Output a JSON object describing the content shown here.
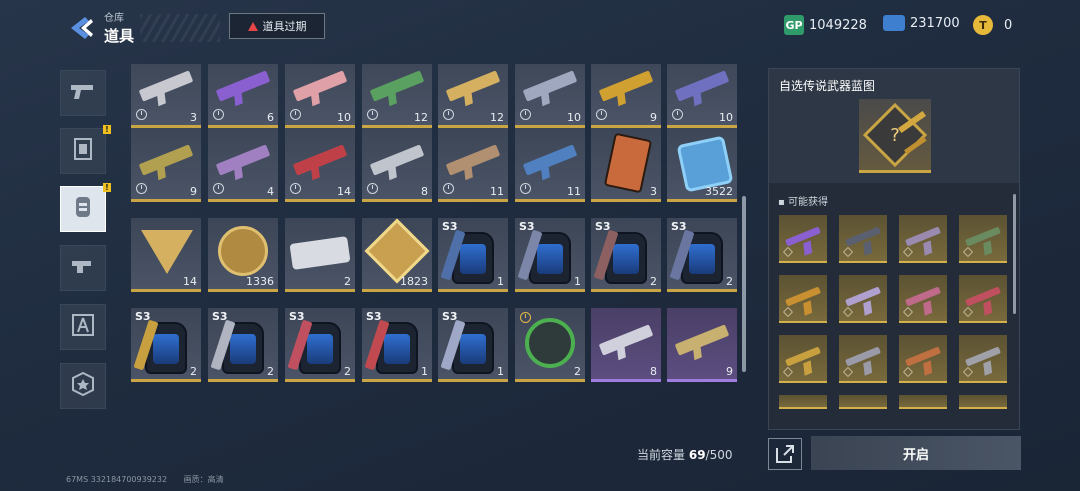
{
  "header": {
    "breadcrumb_parent": "仓库",
    "title": "道具",
    "expire_button": "道具过期"
  },
  "currencies": [
    {
      "icon": "gp-icon",
      "label": "GP",
      "value": "1049228"
    },
    {
      "icon": "ticket-icon",
      "value": "231700"
    },
    {
      "icon": "gold-coin-icon",
      "value": "0"
    }
  ],
  "side_tabs": [
    {
      "name": "weapons",
      "icon": "pistol-icon",
      "badge": false,
      "active": false
    },
    {
      "name": "cards",
      "icon": "card-icon",
      "badge": true,
      "active": false
    },
    {
      "name": "items",
      "icon": "item-icon",
      "badge": true,
      "active": true
    },
    {
      "name": "attachments",
      "icon": "gun-part-icon",
      "badge": false,
      "active": false
    },
    {
      "name": "blueprints",
      "icon": "blueprint-icon",
      "badge": false,
      "active": false
    },
    {
      "name": "badges",
      "icon": "star-badge-icon",
      "badge": false,
      "active": false
    }
  ],
  "grid": {
    "rows": [
      [
        {
          "kind": "gun",
          "color": "#c8c8d0",
          "qty": "3",
          "timer": true
        },
        {
          "kind": "gun",
          "color": "#8a5fd0",
          "qty": "6",
          "timer": true
        },
        {
          "kind": "gun",
          "color": "#e0a0a8",
          "qty": "10",
          "timer": true
        },
        {
          "kind": "gun",
          "color": "#5aa060",
          "qty": "12",
          "timer": true
        },
        {
          "kind": "gun",
          "color": "#d4b060",
          "qty": "12",
          "timer": true
        },
        {
          "kind": "gun",
          "color": "#a0a8c0",
          "qty": "10",
          "timer": true
        },
        {
          "kind": "gun",
          "color": "#d0a030",
          "qty": "9",
          "timer": true
        },
        {
          "kind": "gun",
          "color": "#7070c0",
          "qty": "10",
          "timer": true
        }
      ],
      [
        {
          "kind": "gun",
          "color": "#b0a050",
          "qty": "9",
          "timer": true
        },
        {
          "kind": "gun",
          "color": "#a080c0",
          "qty": "4",
          "timer": true
        },
        {
          "kind": "gun",
          "color": "#c04048",
          "qty": "14",
          "timer": true
        },
        {
          "kind": "gun",
          "color": "#c0c4cc",
          "qty": "8",
          "timer": true
        },
        {
          "kind": "gun",
          "color": "#b09070",
          "qty": "11",
          "timer": true
        },
        {
          "kind": "gun",
          "color": "#5080c0",
          "qty": "11",
          "timer": true
        },
        {
          "kind": "card",
          "color": "#c86a3c",
          "qty": "3",
          "timer": false
        },
        {
          "kind": "chip",
          "color": "#5aa0d8",
          "qty": "3522",
          "timer": false
        }
      ],
      [
        {
          "kind": "triangle",
          "color": "#d4b060",
          "qty": "14",
          "timer": false
        },
        {
          "kind": "coin",
          "color": "#b08a40",
          "qty": "1336",
          "timer": false
        },
        {
          "kind": "bar",
          "color": "#d8dce2",
          "qty": "2",
          "timer": false
        },
        {
          "kind": "hex",
          "color": "#c8a050",
          "qty": "1823",
          "timer": false
        },
        {
          "kind": "pack",
          "color": "#4f6fa8",
          "qty": "1",
          "s3": "S3"
        },
        {
          "kind": "pack",
          "color": "#7c86a8",
          "qty": "1",
          "s3": "S3"
        },
        {
          "kind": "pack",
          "color": "#8c6060",
          "qty": "2",
          "s3": "S3"
        },
        {
          "kind": "pack",
          "color": "#6a76a0",
          "qty": "2",
          "s3": "S3"
        }
      ],
      [
        {
          "kind": "pack",
          "color": "#c8a040",
          "qty": "2",
          "s3": "S3"
        },
        {
          "kind": "pack",
          "color": "#b0b4c0",
          "qty": "2",
          "s3": "S3"
        },
        {
          "kind": "pack",
          "color": "#c05060",
          "qty": "2",
          "s3": "S3"
        },
        {
          "kind": "pack",
          "color": "#c04a50",
          "qty": "1",
          "s3": "S3"
        },
        {
          "kind": "pack",
          "color": "#a0a8c8",
          "qty": "1",
          "s3": "S3"
        },
        {
          "kind": "emblem",
          "color": "#4caf50",
          "qty": "2",
          "timer_gold": true
        },
        {
          "kind": "gun",
          "color": "#d0d0dc",
          "qty": "8",
          "purple": true
        },
        {
          "kind": "gun",
          "color": "#c8b070",
          "qty": "9",
          "purple": true
        }
      ]
    ]
  },
  "capacity": {
    "label": "当前容量",
    "used": "69",
    "total": "/500"
  },
  "panel": {
    "title": "自选传说武器蓝图",
    "loot_label": "可能获得",
    "loot_colors": [
      "#8a5fd0",
      "#5a6070",
      "#9a8ab0",
      "#6a8a60",
      "#c89030",
      "#b0a0d0",
      "#c06a8a",
      "#c05060",
      "#c8a040",
      "#9a9aa8",
      "#c07040",
      "#a0a0a8"
    ],
    "open_button": "开启"
  },
  "footer": {
    "left": "67MS  3321847009392​32",
    "quality": "画质：高清"
  }
}
